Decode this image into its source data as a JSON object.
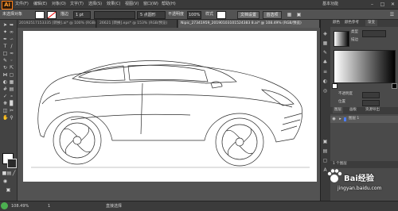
{
  "app": {
    "logo": "Ai"
  },
  "menubar": {
    "items": [
      "文件(F)",
      "编辑(E)",
      "对象(O)",
      "文字(T)",
      "选择(S)",
      "效果(C)",
      "视图(V)",
      "窗口(W)",
      "帮助(H)"
    ],
    "workspace": "基本功能"
  },
  "control_bar": {
    "selection_label": "未选择对象",
    "stroke_label": "描边",
    "stroke_value": "1 pt",
    "brush_value": "5 点圆形",
    "opacity_label": "不透明度",
    "opacity_value": "100%",
    "style_label": "样式",
    "doc_setup_button": "文档设置",
    "prefs_button": "首选项",
    "fill_color": "#ffffff",
    "stroke_color": "#ffffff"
  },
  "tabs": [
    {
      "label": "20192517153335 [转换].ai* @ 100% (RGB/预览)"
    },
    {
      "label": "26621 [转换].eps* @ 153% (RGB/预览)"
    },
    {
      "label": "Nipic_27341959_20190103101524383 8.ai* @ 108.49% (RGB/预览)",
      "active": true
    }
  ],
  "panels": {
    "tabs": [
      "颜色",
      "颜色参考",
      "渐变"
    ],
    "gradient_type_label": "类型",
    "stroke_label": "描边",
    "opacity_label": "不透明度",
    "position_label": "位置",
    "layers_tabs": [
      "图层",
      "画板",
      "资源导出"
    ],
    "layer_name": "图层 1",
    "layers_count": "1 个图层"
  },
  "statusbar": {
    "zoom": "108.49%",
    "artboard_number": "1",
    "tool_name": "直接选择"
  },
  "watermark": {
    "title": "Bai经验",
    "url": "jingyan.baidu.com"
  }
}
